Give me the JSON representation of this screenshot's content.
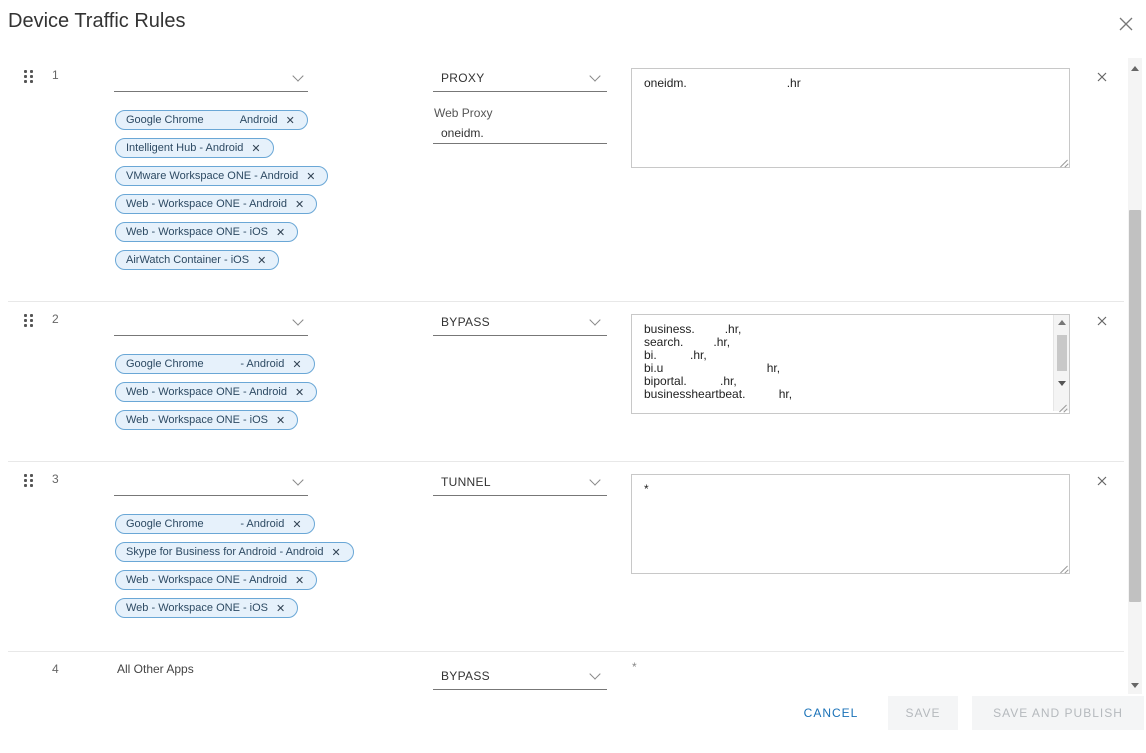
{
  "dialog": {
    "title": "Device Traffic Rules"
  },
  "rules": [
    {
      "number": "1",
      "apps": [
        "Google Chrome            Android",
        "Intelligent Hub - Android",
        "VMware Workspace ONE - Android",
        "Web - Workspace ONE - Android",
        "Web - Workspace ONE - iOS",
        "AirWatch Container - iOS"
      ],
      "action": "PROXY",
      "proxy_label": "Web Proxy",
      "proxy_value": "oneidm.",
      "destinations": "oneidm.                              .hr"
    },
    {
      "number": "2",
      "apps": [
        "Google Chrome            - Android",
        "Web - Workspace ONE - Android",
        "Web - Workspace ONE - iOS"
      ],
      "action": "BYPASS",
      "destinations": "business.         .hr,\nsearch.         .hr,\nbi.          .hr,\nbi.u                               hr,\nbiportal.          .hr,\nbusinessheartbeat.          hr,"
    },
    {
      "number": "3",
      "apps": [
        "Google Chrome            - Android",
        "Skype for Business for Android - Android",
        "Web - Workspace ONE - Android",
        "Web - Workspace ONE - iOS"
      ],
      "action": "TUNNEL",
      "destinations": "*"
    },
    {
      "number": "4",
      "label": "All Other Apps",
      "action": "BYPASS",
      "destinations": "*"
    }
  ],
  "footer": {
    "cancel_label": "CANCEL",
    "save_label": "SAVE",
    "save_publish_label": "SAVE AND PUBLISH"
  },
  "colors": {
    "chip_border": "#6aa7d6",
    "chip_bg": "#e6f1fb",
    "link_blue": "#1a72b8",
    "disabled_text": "#b5b9bd"
  }
}
